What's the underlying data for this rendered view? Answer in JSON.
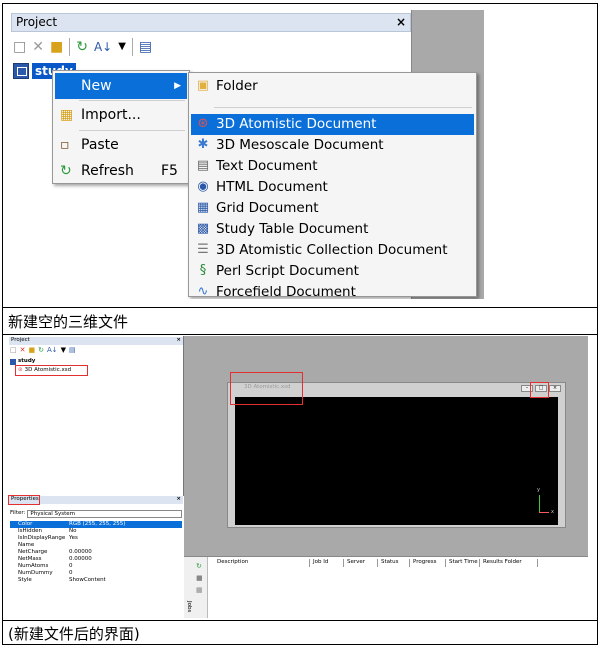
{
  "top": {
    "project_title": "Project",
    "close_glyph": "×",
    "toolbar_icons": [
      "new-icon",
      "delete-icon",
      "open-folder-icon",
      "refresh-icon",
      "sort-icon",
      "dropdown-icon",
      "help-icon"
    ],
    "tree_item": "study",
    "context_menu": [
      {
        "label": "New",
        "shortcut": "",
        "highlighted": true,
        "submenu": true
      },
      {
        "label": "Import...",
        "shortcut": "",
        "highlighted": false
      },
      {
        "label": "Paste",
        "shortcut": "",
        "highlighted": false
      },
      {
        "label": "Refresh",
        "shortcut": "F5",
        "highlighted": false
      }
    ],
    "submenu": [
      "Folder",
      "3D Atomistic Document",
      "3D Mesoscale Document",
      "Text Document",
      "HTML Document",
      "Grid Document",
      "Study Table Document",
      "3D Atomistic Collection Document",
      "Perl Script Document",
      "Forcefield Document"
    ],
    "submenu_highlight": "3D Atomistic Document"
  },
  "caption1": "新建空的三维文件",
  "bottom": {
    "project_title": "Project",
    "tree_item": "study",
    "doc_item": "3D Atomistic.xsd",
    "properties_title": "Properties",
    "filter_label": "Filter:",
    "filter_value": "Physical System",
    "properties": [
      {
        "key": "Color",
        "value": "RGB (255, 255, 255)",
        "selected": true
      },
      {
        "key": "IsHidden",
        "value": "No"
      },
      {
        "key": "IsInDisplayRange",
        "value": "Yes"
      },
      {
        "key": "Name",
        "value": ""
      },
      {
        "key": "NetCharge",
        "value": "0.00000"
      },
      {
        "key": "NetMass",
        "value": "0.00000"
      },
      {
        "key": "NumAtoms",
        "value": "0"
      },
      {
        "key": "NumDummy",
        "value": "0"
      },
      {
        "key": "Style",
        "value": "ShowContent"
      }
    ],
    "doc_window_title": "3D Atomistic.xsd",
    "axis_labels": {
      "x": "x",
      "y": "y"
    },
    "jobs_side_label": "Jobs",
    "job_columns": [
      "Description",
      "Job Id",
      "Server",
      "Status",
      "Progress",
      "Start Time",
      "Results Folder"
    ]
  },
  "caption2": "(新建文件后的界面)"
}
